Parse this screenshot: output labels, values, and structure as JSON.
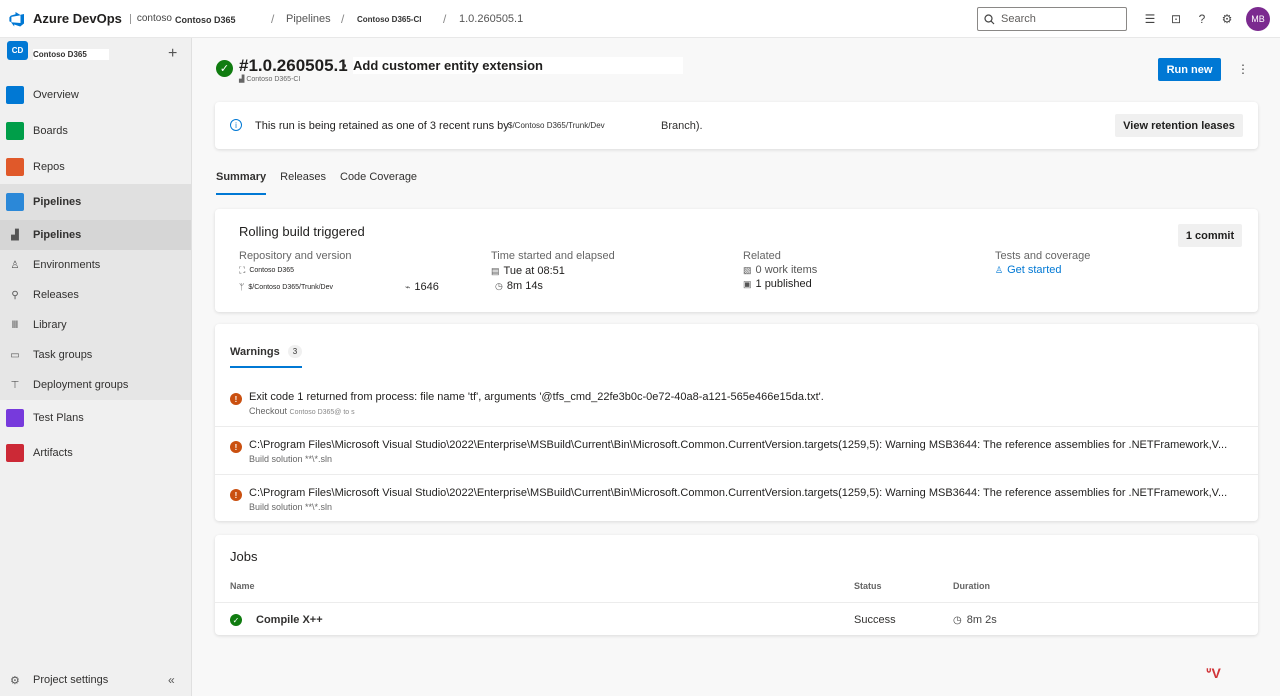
{
  "topbar": {
    "brand": "Azure DevOps",
    "org": "contoso",
    "project": "Contoso D365",
    "crumb_pipelines": "Pipelines",
    "crumb_pipeline": "Contoso D365-CI",
    "crumb_run": "1.0.260505.1",
    "search_placeholder": "Search",
    "avatar": "MB"
  },
  "sidebar": {
    "project_badge": "CD",
    "project_name": "Contoso D365",
    "items": [
      {
        "label": "Overview",
        "color": "#0078d4"
      },
      {
        "label": "Boards",
        "color": "#009e49"
      },
      {
        "label": "Repos",
        "color": "#e0592a"
      },
      {
        "label": "Pipelines",
        "color": "#2b88d8"
      }
    ],
    "sub_items": [
      {
        "label": "Pipelines"
      },
      {
        "label": "Environments"
      },
      {
        "label": "Releases"
      },
      {
        "label": "Library"
      },
      {
        "label": "Task groups"
      },
      {
        "label": "Deployment groups"
      }
    ],
    "items2": [
      {
        "label": "Test Plans",
        "color": "#773adc"
      },
      {
        "label": "Artifacts",
        "color": "#cc2936"
      }
    ],
    "settings": "Project settings"
  },
  "run": {
    "number": "#1.0.260505.1",
    "separator": "•",
    "message": "Add customer entity extension",
    "pipeline": "Contoso D365-CI",
    "run_new": "Run new"
  },
  "banner": {
    "text": "This run is being retained as one of 3 recent runs by",
    "path": "$/Contoso D365/Trunk/Dev",
    "tail": "Branch).",
    "button": "View retention leases"
  },
  "tabs": [
    "Summary",
    "Releases",
    "Code Coverage"
  ],
  "summary": {
    "title": "Rolling build triggered",
    "commit_button": "1 commit",
    "repo_heading": "Repository and version",
    "repo_name": "Contoso D365",
    "repo_path": "$/Contoso D365/Trunk/Dev",
    "changeset": "1646",
    "time_heading": "Time started and elapsed",
    "started": "Tue at 08:51",
    "elapsed": "8m 14s",
    "related_heading": "Related",
    "work_items": "0 work items",
    "published": "1 published",
    "tests_heading": "Tests and coverage",
    "tests_link": "Get started"
  },
  "warnings": {
    "tab": "Warnings",
    "count": "3",
    "rows": [
      {
        "msg": "Exit code 1 returned from process: file name 'tf', arguments '@tfs_cmd_22fe3b0c-0e72-40a8-a121-565e466e15da.txt'.",
        "sub": "Checkout",
        "sub_small": "Contoso D365@ to s"
      },
      {
        "msg": "C:\\Program Files\\Microsoft Visual Studio\\2022\\Enterprise\\MSBuild\\Current\\Bin\\Microsoft.Common.CurrentVersion.targets(1259,5): Warning MSB3644: The reference assemblies for .NETFramework,V...",
        "sub": "Build solution **\\*.sln",
        "sub_small": ""
      },
      {
        "msg": "C:\\Program Files\\Microsoft Visual Studio\\2022\\Enterprise\\MSBuild\\Current\\Bin\\Microsoft.Common.CurrentVersion.targets(1259,5): Warning MSB3644: The reference assemblies for .NETFramework,V...",
        "sub": "Build solution **\\*.sln",
        "sub_small": ""
      }
    ]
  },
  "jobs": {
    "title": "Jobs",
    "col_name": "Name",
    "col_status": "Status",
    "col_duration": "Duration",
    "rows": [
      {
        "name": "Compile X++",
        "status": "Success",
        "duration": "8m 2s"
      }
    ]
  }
}
